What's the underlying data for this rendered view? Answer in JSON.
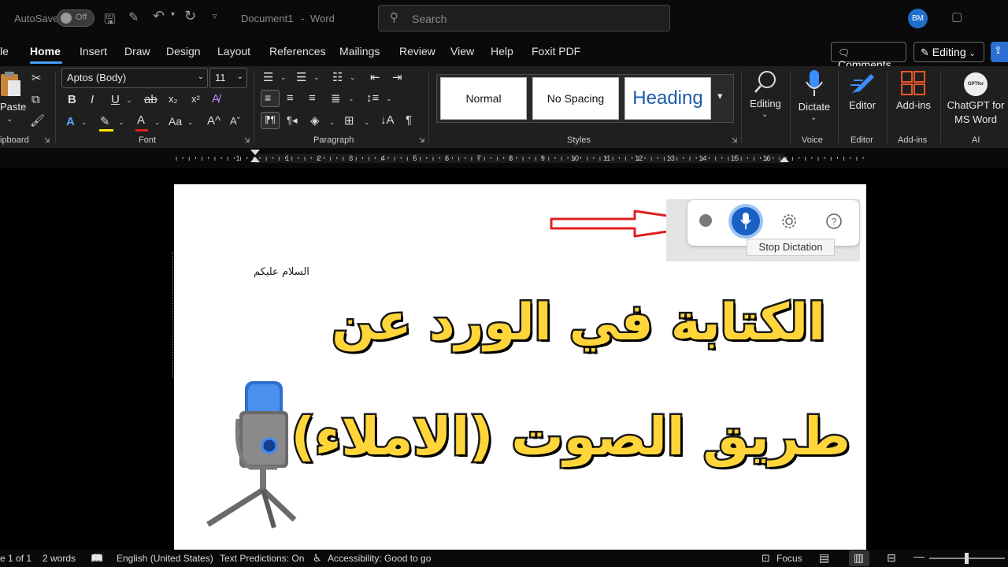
{
  "titlebar": {
    "autosave_label": "AutoSave",
    "autosave_state": "Off",
    "doc_title": "Document1",
    "title_sep": "-",
    "app_name": "Word",
    "search_placeholder": "Search",
    "user_initials": "BM"
  },
  "tabs": [
    {
      "label": "le"
    },
    {
      "label": "Home"
    },
    {
      "label": "Insert"
    },
    {
      "label": "Draw"
    },
    {
      "label": "Design"
    },
    {
      "label": "Layout"
    },
    {
      "label": "References"
    },
    {
      "label": "Mailings"
    },
    {
      "label": "Review"
    },
    {
      "label": "View"
    },
    {
      "label": "Help"
    },
    {
      "label": "Foxit PDF"
    }
  ],
  "tab_buttons": {
    "comments": "Comments",
    "editing": "Editing"
  },
  "ribbon": {
    "clipboard": {
      "paste": "Paste",
      "label": "ipboard"
    },
    "font": {
      "font_name": "Aptos (Body)",
      "font_size": "11",
      "label": "Font"
    },
    "paragraph": {
      "label": "Paragraph"
    },
    "styles": {
      "normal": "Normal",
      "no_spacing": "No Spacing",
      "heading": "Heading",
      "label": "Styles"
    },
    "editing": {
      "label": "Editing"
    },
    "voice": {
      "dictate": "Dictate",
      "label": "Voice"
    },
    "editor": {
      "button": "Editor",
      "label": "Editor"
    },
    "addins": {
      "button": "Add-ins",
      "label": "Add-ins"
    },
    "ai": {
      "line1": "ChatGPT for",
      "line2": "MS Word",
      "logo_text": "GPTfor Word",
      "label": "AI"
    }
  },
  "ruler": {
    "numbers": [
      "1",
      "1",
      "2",
      "3",
      "4",
      "5",
      "6",
      "7",
      "8",
      "9",
      "10",
      "11",
      "12",
      "13",
      "14",
      "15",
      "16"
    ]
  },
  "document": {
    "body_text": "السلام عليكم",
    "headline_line1": "الكتابة  في الورد عن",
    "headline_line2": "طريق الصوت (الاملاء)"
  },
  "dictation": {
    "tooltip": "Stop Dictation"
  },
  "status": {
    "page": "e 1 of 1",
    "words": "2 words",
    "language": "English (United States)",
    "predictions": "Text Predictions: On",
    "accessibility": "Accessibility: Good to go",
    "focus": "Focus"
  },
  "colors": {
    "accent": "#4aa0ff",
    "mic_blue": "#1a5fc4",
    "headline_yellow": "#ffd53a",
    "arrow_red": "#e02020"
  }
}
